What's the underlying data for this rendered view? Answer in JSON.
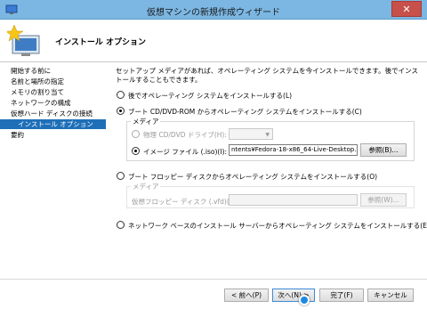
{
  "window": {
    "title": "仮想マシンの新規作成ウィザード",
    "close_glyph": "✕"
  },
  "header": {
    "title": "インストール オプション"
  },
  "sidebar": {
    "items": [
      {
        "label": "開始する前に"
      },
      {
        "label": "名前と場所の指定"
      },
      {
        "label": "メモリの割り当て"
      },
      {
        "label": "ネットワークの構成"
      },
      {
        "label": "仮想ハード ディスクの接続"
      },
      {
        "label": "インストール オプション"
      },
      {
        "label": "要約"
      }
    ]
  },
  "content": {
    "description": "セットアップ メディアがあれば、オペレーティング システムを今インストールできます。後でインストールすることもできます。",
    "options": {
      "later": "後でオペレーティング システムをインストールする(L)",
      "cd": "ブート CD/DVD-ROM からオペレーティング システムをインストールする(C)",
      "floppy": "ブート フロッピー ディスクからオペレーティング システムをインストールする(O)",
      "network": "ネットワーク ベースのインストール サーバーからオペレーティング システムをインストールする(E)"
    },
    "cd_media": {
      "group_title": "メディア",
      "physical_label": "物理 CD/DVD ドライブ(H):",
      "image_label": "イメージ ファイル (.iso)(I):",
      "image_value": "ntents¥Fedora-18-x86_64-Live-Desktop.iso",
      "browse": "参照(B)..."
    },
    "floppy_media": {
      "group_title": "メディア",
      "vfd_label": "仮想フロッピー ディスク (.vfd)(V):",
      "browse": "参照(W)..."
    }
  },
  "footer": {
    "back": "< 前へ(P)",
    "next": "次へ(N) >",
    "finish": "完了(F)",
    "cancel": "キャンセル"
  }
}
